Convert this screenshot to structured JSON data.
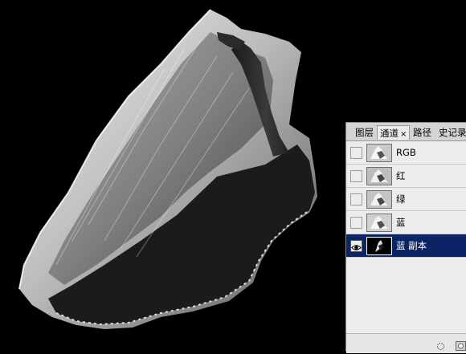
{
  "canvas": {
    "description_icon": "image-canvas"
  },
  "channels_panel": {
    "tabs": [
      {
        "label": "图层",
        "active": false
      },
      {
        "label": "通道",
        "active": true,
        "close_symbol": "×"
      },
      {
        "label": "路径",
        "active": false
      },
      {
        "label": "史记录",
        "active": false
      }
    ],
    "rows": [
      {
        "label": "RGB",
        "visible": false,
        "selected": false,
        "thumb_icon": "veil-thumbnail"
      },
      {
        "label": "红",
        "visible": false,
        "selected": false,
        "thumb_icon": "veil-thumbnail"
      },
      {
        "label": "绿",
        "visible": false,
        "selected": false,
        "thumb_icon": "veil-thumbnail"
      },
      {
        "label": "蓝",
        "visible": false,
        "selected": false,
        "thumb_icon": "veil-thumbnail"
      },
      {
        "label": "蓝 副本",
        "visible": true,
        "selected": true,
        "thumb_icon": "dark-veil-thumbnail"
      }
    ],
    "bottom_icons": [
      "load-selection-icon",
      "save-selection-icon"
    ]
  },
  "colors": {
    "selection": "#0a2466",
    "panel_bg": "#ececec",
    "canvas_bg": "#000000"
  }
}
